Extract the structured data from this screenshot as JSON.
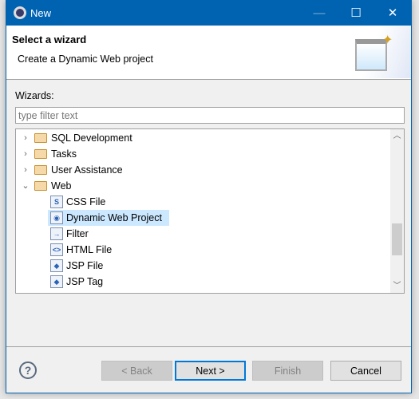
{
  "window": {
    "title": "New",
    "minimize": "—",
    "maximize": "☐",
    "close": "✕"
  },
  "header": {
    "title": "Select a wizard",
    "description": "Create a Dynamic Web project"
  },
  "wizards_label": "Wizards:",
  "filter": {
    "placeholder": "type filter text",
    "value": ""
  },
  "tree": {
    "items": [
      {
        "label": "SQL Development",
        "type": "folder",
        "expanded": false
      },
      {
        "label": "Tasks",
        "type": "folder",
        "expanded": false
      },
      {
        "label": "User Assistance",
        "type": "folder",
        "expanded": false
      },
      {
        "label": "Web",
        "type": "folder",
        "expanded": true
      },
      {
        "label": "CSS File",
        "type": "file",
        "icon": "css-file-icon"
      },
      {
        "label": "Dynamic Web Project",
        "type": "file",
        "icon": "web-project-icon",
        "selected": true
      },
      {
        "label": "Filter",
        "type": "file",
        "icon": "filter-icon"
      },
      {
        "label": "HTML File",
        "type": "file",
        "icon": "html-file-icon"
      },
      {
        "label": "JSP File",
        "type": "file",
        "icon": "jsp-file-icon"
      },
      {
        "label": "JSP Tag",
        "type": "file",
        "icon": "jsp-tag-icon"
      }
    ]
  },
  "buttons": {
    "back": "< Back",
    "next": "Next >",
    "finish": "Finish",
    "cancel": "Cancel"
  },
  "colors": {
    "titlebar": "#0063b1",
    "selection": "#cce8ff",
    "default_button_border": "#0078d7"
  }
}
